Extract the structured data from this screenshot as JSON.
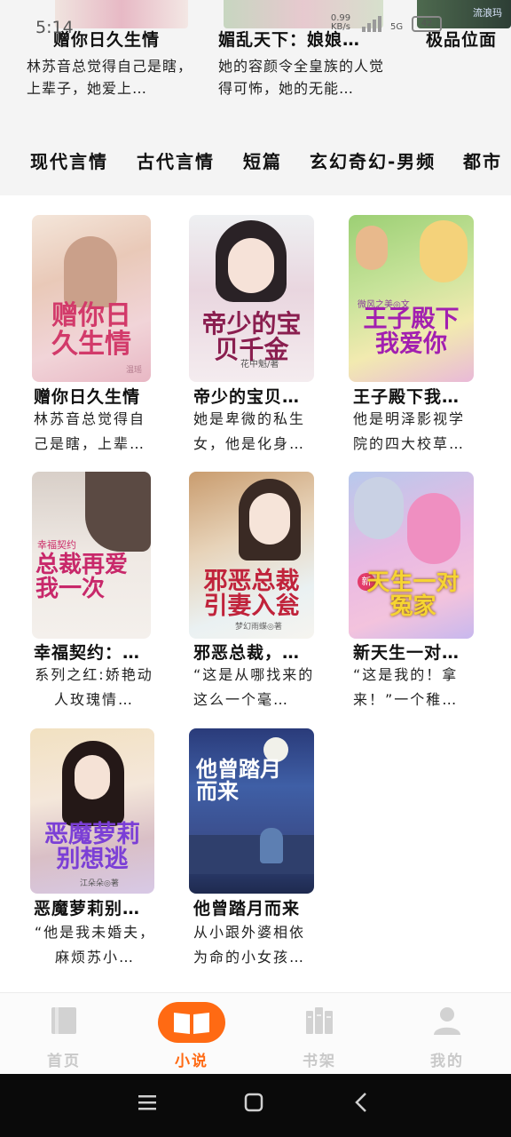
{
  "status": {
    "time": "5:14",
    "speed": "0.99 KB/s",
    "network": "5G",
    "battery": "42"
  },
  "prev_row": {
    "items": [
      {
        "title": "赠你日久生情",
        "desc": "林苏音总觉得自己是瞎，上辈子，她爱上…"
      },
      {
        "title": "媚乱天下：娘娘…",
        "desc": "她的容颜令全皇族的人觉得可怖，她的无能…"
      },
      {
        "title": "极品位面",
        "desc": ""
      }
    ],
    "cover_badge": "流浪玛"
  },
  "categories": [
    "现代言情",
    "古代言情",
    "短篇",
    "玄幻奇幻-男频",
    "都市"
  ],
  "books": [
    {
      "title": "赠你日久生情",
      "desc": "林苏音总觉得自己是瞎，上辈…",
      "cover_text": "赠你日久生情",
      "cover_author": "温瑶"
    },
    {
      "title": "帝少的宝贝…",
      "desc": "她是卑微的私生女，他是化身…",
      "cover_text": "帝少的宝贝千金",
      "cover_author": "花中魁/著"
    },
    {
      "title": "王子殿下我…",
      "desc": "他是明泽影视学院的四大校草…",
      "cover_text": "王子殿下我爱你",
      "cover_author": "微风之美◎文"
    },
    {
      "title": "幸福契约：…",
      "desc": "系列之红:娇艳动人玫瑰情…",
      "cover_text": "总裁再爱我一次",
      "cover_author": "幸福契约"
    },
    {
      "title": "邪恶总裁，…",
      "desc": "“这是从哪找来的这么一个毫…",
      "cover_text": "邪恶总裁引妻入瓮",
      "cover_author": "梦幻雨蝶◎著"
    },
    {
      "title": "新天生一对…",
      "desc": "“这是我的！拿来！”一个稚…",
      "cover_text": "天生一对冤家",
      "cover_author": "新"
    },
    {
      "title": "恶魔萝莉别…",
      "desc": "“他是我未婚夫，麻烦苏小…",
      "cover_text": "恶魔萝莉别想逃",
      "cover_author": "江朵朵◎著"
    },
    {
      "title": "他曾踏月而来",
      "desc": "从小跟外婆相依为命的小女孩…",
      "cover_text": "他曾踏月而来",
      "cover_author": ""
    }
  ],
  "nav": [
    {
      "label": "首页",
      "icon": "book-icon",
      "active": false
    },
    {
      "label": "小说",
      "icon": "open-book-icon",
      "active": true
    },
    {
      "label": "书架",
      "icon": "bookshelf-icon",
      "active": false
    },
    {
      "label": "我的",
      "icon": "person-icon",
      "active": false
    }
  ],
  "colors": {
    "accent": "#ff6a13",
    "inactive": "#c9c9c9"
  }
}
